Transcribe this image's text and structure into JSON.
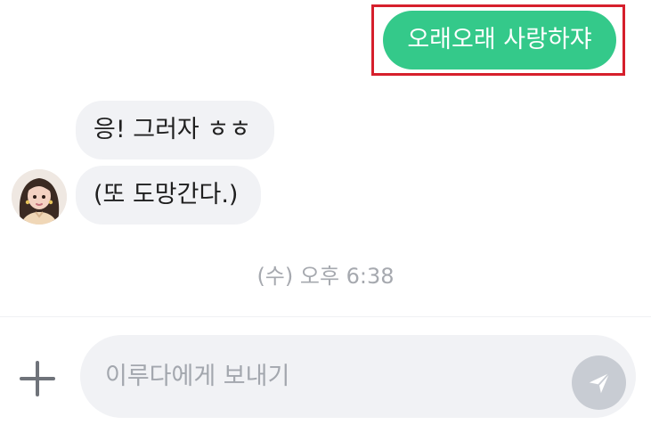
{
  "messages": {
    "sent": [
      {
        "text": "오래오래 사랑하쟈"
      }
    ],
    "received": [
      {
        "text": "응! 그러자 ㅎㅎ"
      },
      {
        "text": "(또 도망간다.)"
      }
    ],
    "timestamp": "(수) 오후 6:38"
  },
  "composer": {
    "placeholder": "이루다에게 보내기",
    "value": "",
    "icons": {
      "add": "plus-icon",
      "send": "send-icon"
    }
  },
  "colors": {
    "sent_bubble": "#34c98a",
    "received_bubble": "#f1f2f5",
    "highlight": "#d61f2c",
    "send_button_disabled": "#c8ccd3"
  }
}
